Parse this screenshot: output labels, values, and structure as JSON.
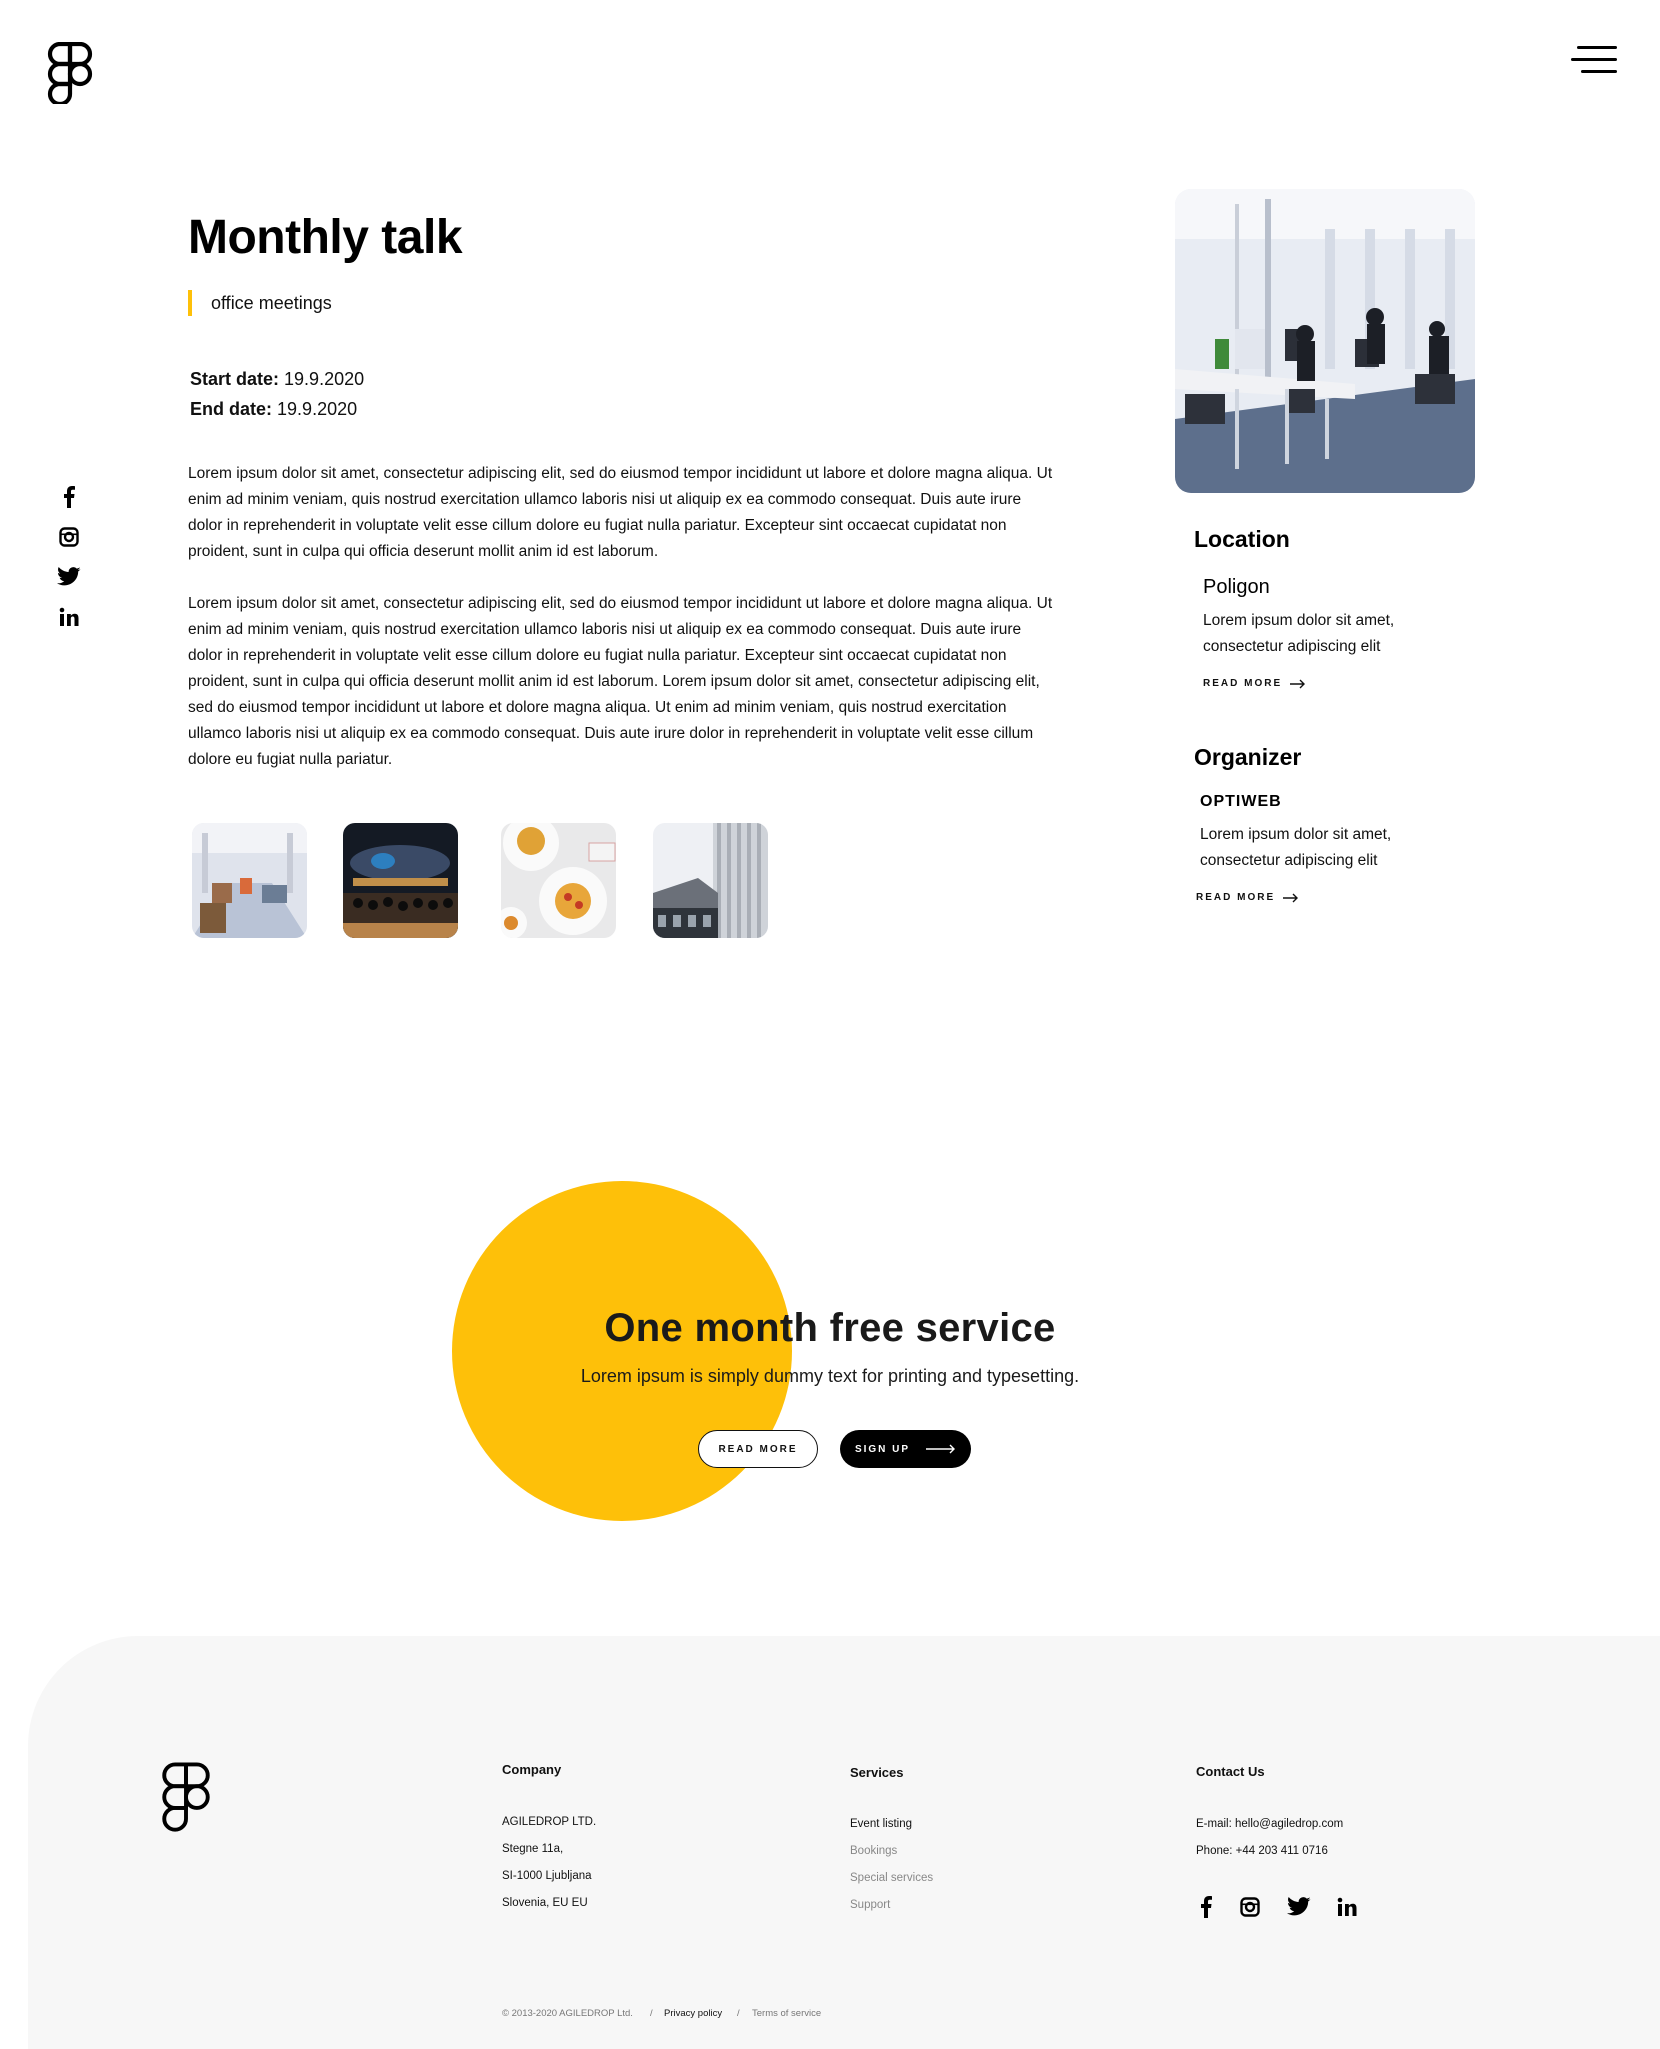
{
  "header": {
    "logo": "figma-logo",
    "menu_icon": "hamburger-menu-icon"
  },
  "social_rail": [
    "facebook-icon",
    "instagram-icon",
    "twitter-icon",
    "linkedin-icon"
  ],
  "article": {
    "title": "Monthly talk",
    "category": "office meetings",
    "start_label": "Start date:",
    "start_value": "19.9.2020",
    "end_label": "End date:",
    "end_value": "19.9.2020",
    "paragraph1": "Lorem ipsum dolor sit amet, consectetur adipiscing elit, sed do eiusmod tempor incididunt ut labore et dolore magna aliqua. Ut enim ad minim veniam, quis nostrud exercitation ullamco laboris nisi ut aliquip ex ea commodo consequat. Duis aute irure dolor in reprehenderit in voluptate velit esse cillum dolore eu fugiat nulla pariatur. Excepteur sint occaecat cupidatat non proident, sunt in culpa qui officia deserunt mollit anim id est laborum.",
    "paragraph2": "Lorem ipsum dolor sit amet, consectetur adipiscing elit, sed do eiusmod tempor incididunt ut labore et dolore magna aliqua. Ut enim ad minim veniam, quis nostrud exercitation ullamco laboris nisi ut aliquip ex ea commodo consequat. Duis aute irure dolor in reprehenderit in voluptate velit esse cillum dolore eu fugiat nulla pariatur. Excepteur sint occaecat cupidatat non proident, sunt in culpa qui officia deserunt mollit anim id est laborum. Lorem ipsum dolor sit amet, consectetur adipiscing elit, sed do eiusmod tempor incididunt ut labore et dolore magna aliqua. Ut enim ad minim veniam, quis nostrud exercitation ullamco laboris nisi ut aliquip ex ea commodo consequat. Duis aute irure dolor in reprehenderit in voluptate velit esse cillum dolore eu fugiat nulla pariatur."
  },
  "sidebar": {
    "location_heading": "Location",
    "location_name": "Poligon",
    "location_text": "Lorem ipsum dolor sit amet, consectetur adipiscing elit",
    "location_read_more": "READ MORE",
    "organizer_heading": "Organizer",
    "organizer_name": "OPTIWEB",
    "organizer_text": "Lorem ipsum dolor sit amet, consectetur adipiscing elit",
    "organizer_read_more": "READ MORE"
  },
  "promo": {
    "title": "One month free service",
    "subtitle": "Lorem ipsum is simply dummy text for printing and typesetting.",
    "read_more": "READ MORE",
    "sign_up": "SIGN UP"
  },
  "footer": {
    "company_heading": "Company",
    "company_lines": [
      "AGILEDROP LTD.",
      "Stegne 11a,",
      "SI-1000 Ljubljana",
      "Slovenia, EU EU"
    ],
    "services_heading": "Services",
    "services": [
      "Event listing",
      "Bookings",
      "Special services",
      "Support"
    ],
    "contact_heading": "Contact Us",
    "email": "E-mail: hello@agiledrop.com",
    "phone": "Phone: +44 203 411 0716",
    "social": [
      "facebook-icon",
      "instagram-icon",
      "twitter-icon",
      "linkedin-icon"
    ],
    "copyright": "© 2013-2020 AGILEDROP Ltd.",
    "separator": "/",
    "privacy": "Privacy policy",
    "terms": "Terms of service"
  },
  "colors": {
    "accent": "#FEC009",
    "footer_bg": "#F7F7F7",
    "text": "#111111"
  }
}
